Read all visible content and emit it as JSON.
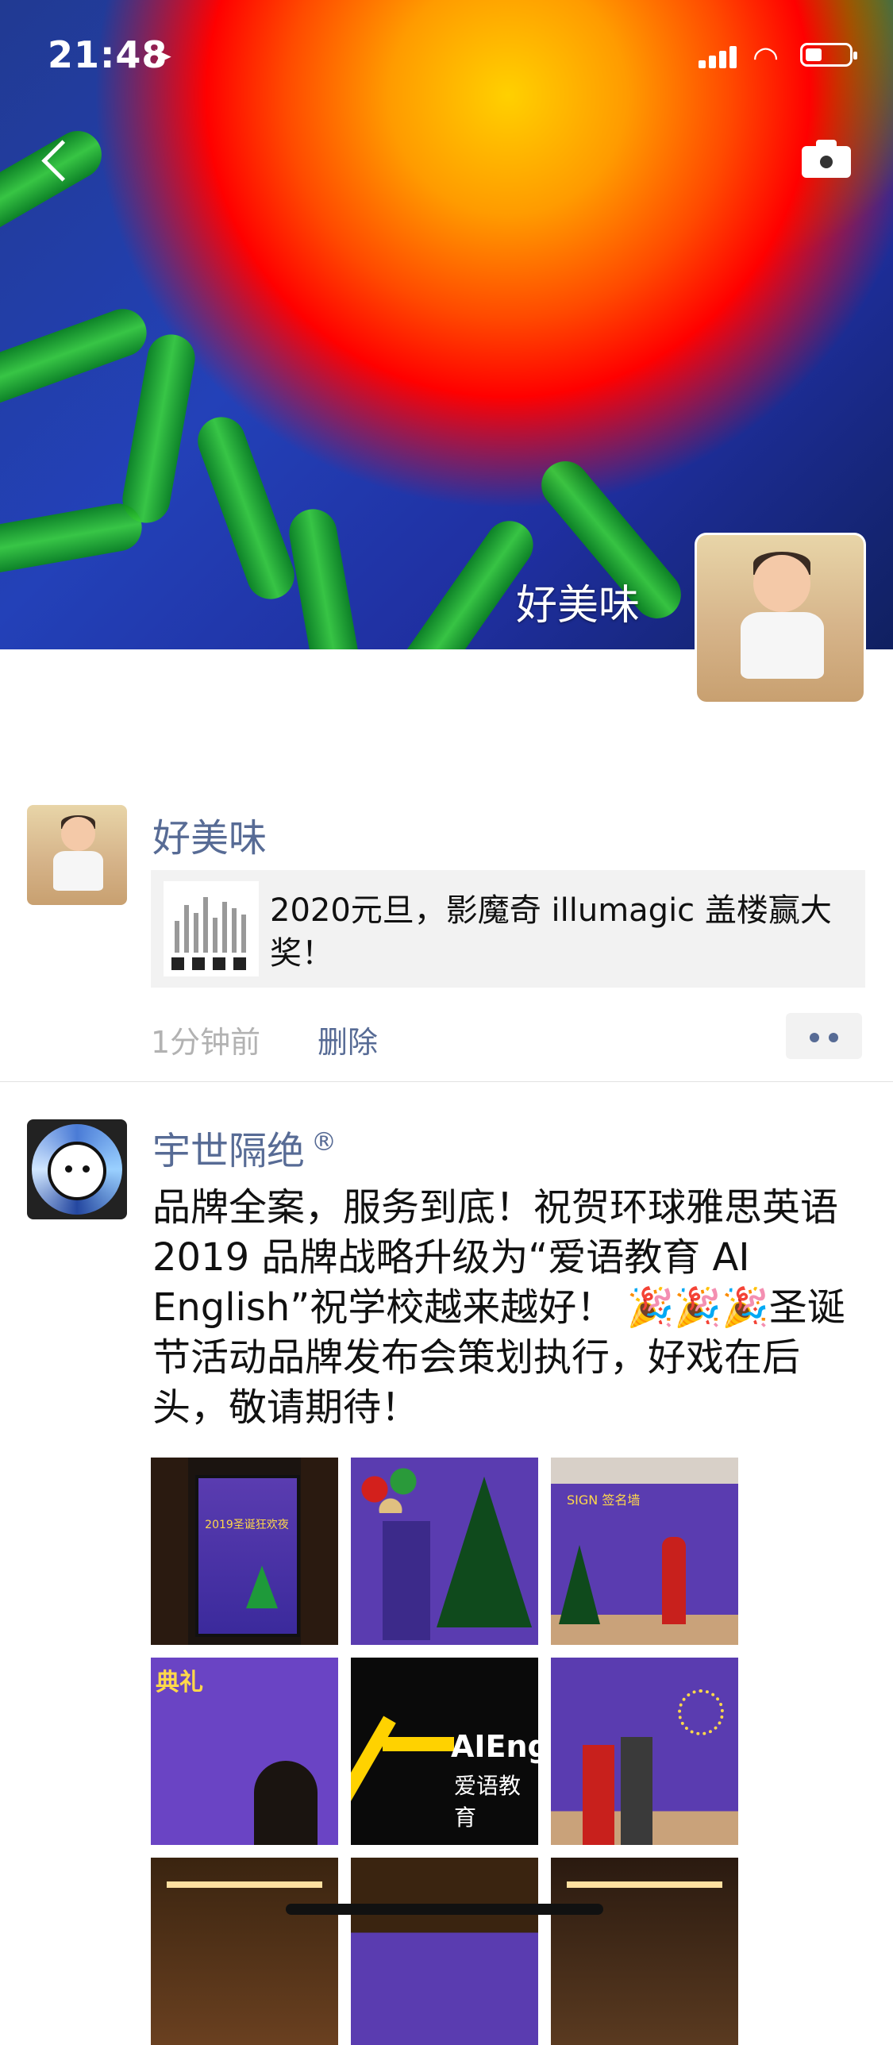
{
  "status_bar": {
    "time": "21:48",
    "location_icon": "location-arrow-icon",
    "signal_icon": "signal-icon",
    "wifi_icon": "wifi-icon",
    "battery_icon": "battery-icon"
  },
  "header": {
    "back_icon": "chevron-left-icon",
    "camera_icon": "camera-icon",
    "cover_name": "好美味"
  },
  "post1": {
    "username": "好美味",
    "share_text": "2020元旦，影魔奇 illumagic 盖楼赢大奖！",
    "time": "1分钟前",
    "delete_label": "删除",
    "more_icon": "more-dots-icon"
  },
  "post2": {
    "username": "宇世隔绝",
    "badge": "®",
    "text": "品牌全案，服务到底！祝贺环球雅思英语 2019 品牌战略升级为“爱语教育 AI English”祝学校越来越好！ 🎉🎉🎉圣诞节活动品牌发布会策划执行，好戏在后头，敬请期待！",
    "photo_count": 9,
    "photo_texts": {
      "photo5": "AIEngli",
      "photo5_sub": "爱语教育",
      "photo1_title": "2019圣诞狂欢夜",
      "photo3_sign": "SIGN 签名墙",
      "photo4_text": "典礼"
    }
  },
  "colors": {
    "link": "#576b95",
    "meta": "#b2b2b2",
    "card_bg": "#f2f2f2",
    "divider": "#e2e2e2"
  }
}
